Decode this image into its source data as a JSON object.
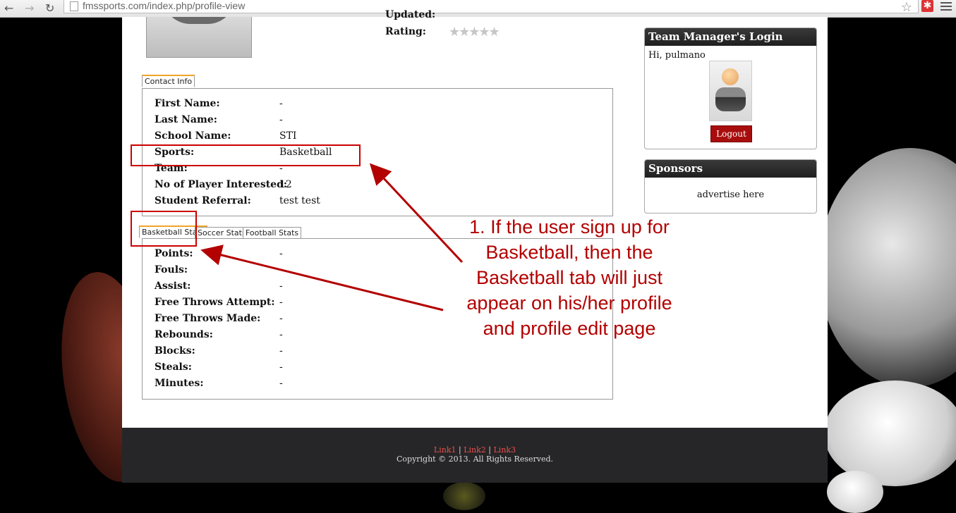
{
  "browser": {
    "url": "fmssports.com/index.php/profile-view",
    "back_icon": "back-arrow-icon",
    "forward_icon": "forward-arrow-icon",
    "reload_icon": "reload-icon"
  },
  "profile": {
    "updated_label": "Updated:",
    "rating_label": "Rating:",
    "rating_stars": "★★★★★",
    "rating_value": 0
  },
  "contact_tab": {
    "label": "Contact Info"
  },
  "contact": [
    {
      "label": "First Name:",
      "value": "-"
    },
    {
      "label": "Last Name:",
      "value": "-"
    },
    {
      "label": "School Name:",
      "value": "STI"
    },
    {
      "label": "Sports:",
      "value": "Basketball"
    },
    {
      "label": "Team:",
      "value": "-"
    },
    {
      "label": "No of Player Interested:",
      "value": "12"
    },
    {
      "label": "Student Referral:",
      "value": "test test"
    }
  ],
  "stats_tabs": [
    "Basketball Stats",
    "Soccer Stats",
    "Football Stats"
  ],
  "stats": [
    {
      "label": "Points:",
      "value": "-"
    },
    {
      "label": "Fouls:",
      "value": ""
    },
    {
      "label": "Assist:",
      "value": "-"
    },
    {
      "label": "Free Throws Attempt:",
      "value": "-"
    },
    {
      "label": "Free Throws Made:",
      "value": "-"
    },
    {
      "label": "Rebounds:",
      "value": "-"
    },
    {
      "label": "Blocks:",
      "value": "-"
    },
    {
      "label": "Steals:",
      "value": "-"
    },
    {
      "label": "Minutes:",
      "value": "-"
    }
  ],
  "sidebar": {
    "login_title": "Team Manager's Login",
    "greeting": "Hi, pulmano",
    "logout_label": "Logout",
    "sponsors_title": "Sponsors",
    "sponsors_text": "advertise here"
  },
  "footer": {
    "link1": "Link1",
    "link2": "Link2",
    "link3": "Link3",
    "separator": "|",
    "copyright": "Copyright © 2013. All Rights Reserved."
  },
  "annotation": {
    "lines": [
      "1. If the user sign up for",
      "Basketball, then the",
      "Basketball tab will just",
      "appear on his/her profile",
      "and profile edit page"
    ],
    "color": "#b30000"
  }
}
